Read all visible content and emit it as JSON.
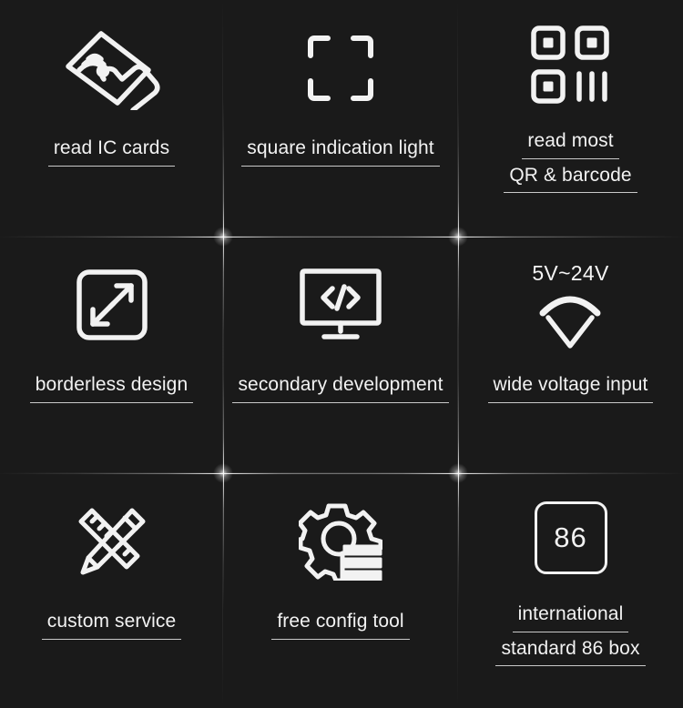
{
  "theme": {
    "background": "#1a1a1a",
    "foreground": "#f2f2f2",
    "rule": "#c9c9c9"
  },
  "features": [
    {
      "id": "read-ic-cards",
      "icon": "contactless-card-hand-icon",
      "lines": [
        "read IC cards"
      ]
    },
    {
      "id": "square-indication-light",
      "icon": "square-bracket-frame-icon",
      "lines": [
        "square indication light"
      ]
    },
    {
      "id": "read-qr-barcode",
      "icon": "qr-code-icon",
      "lines": [
        "read most",
        "QR & barcode"
      ]
    },
    {
      "id": "borderless-design",
      "icon": "expand-arrows-square-icon",
      "lines": [
        "borderless design"
      ]
    },
    {
      "id": "secondary-development",
      "icon": "monitor-code-icon",
      "lines": [
        "secondary development"
      ]
    },
    {
      "id": "wide-voltage-input",
      "icon": "voltage-arc-icon",
      "caption": "5V~24V",
      "lines": [
        "wide voltage input"
      ]
    },
    {
      "id": "custom-service",
      "icon": "pencil-ruler-icon",
      "lines": [
        "custom service"
      ]
    },
    {
      "id": "free-config-tool",
      "icon": "gear-list-icon",
      "lines": [
        "free config tool"
      ]
    },
    {
      "id": "international-standard-86-box",
      "icon": "box-86-icon",
      "box_number": "86",
      "lines": [
        "international",
        "standard 86 box"
      ]
    }
  ]
}
